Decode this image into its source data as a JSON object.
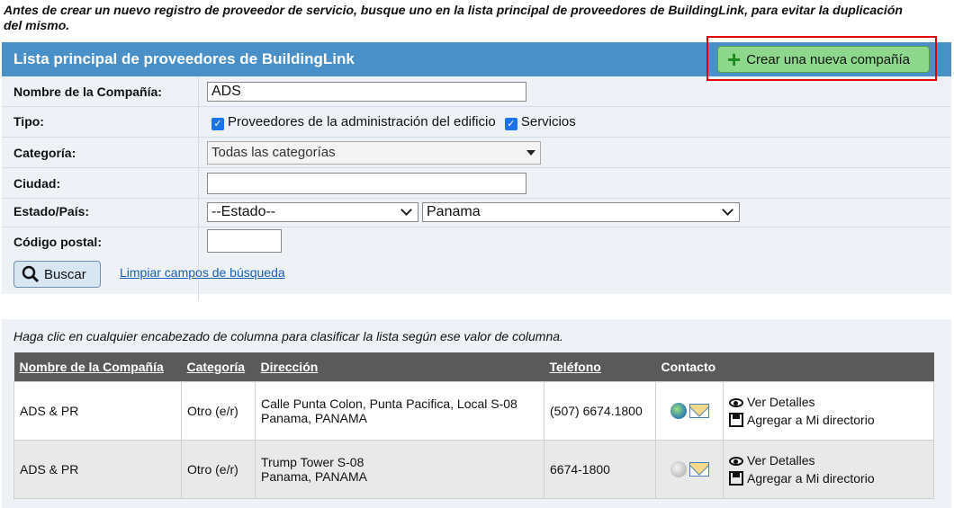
{
  "intro_text": "Antes de crear un nuevo registro de proveedor de servicio, busque uno en la lista principal de proveedores de BuildingLink, para evitar la duplicación del mismo.",
  "panel": {
    "title": "Lista principal de proveedores de BuildingLink",
    "create_button": "Crear una nueva compañía"
  },
  "form": {
    "company_label": "Nombre de la Compañía:",
    "company_value": "ADS",
    "type_label": "Tipo:",
    "type_option1": "Proveedores de la administración del edificio",
    "type_option2": "Servicios",
    "category_label": "Categoría:",
    "category_value": "Todas las categorías",
    "city_label": "Ciudad:",
    "city_value": "",
    "state_label": "Estado/País:",
    "state_value": "--Estado--",
    "country_value": "Panama",
    "zip_label": "Código postal:",
    "zip_value": "",
    "search_button": "Buscar",
    "clear_link": "Limpiar campos de búsqueda"
  },
  "results": {
    "hint": "Haga clic en cualquier encabezado de columna para clasificar la lista según ese valor de columna.",
    "headers": {
      "company": "Nombre de la Compañía",
      "category": "Categoría",
      "address": "Dirección",
      "phone": "Teléfono",
      "contact": "Contacto"
    },
    "rows": [
      {
        "company": "ADS & PR",
        "category": "Otro (e/r)",
        "address1": "Calle Punta Colon, Punta Pacifica, Local S-08",
        "address2": "Panama, PANAMA",
        "phone": "(507) 6674.1800",
        "details": "Ver Detalles",
        "add": "Agregar a Mi directorio"
      },
      {
        "company": "ADS & PR",
        "category": "Otro (e/r)",
        "address1": "Trump Tower S-08",
        "address2": "Panama, PANAMA",
        "phone": "6674-1800",
        "details": "Ver Detalles",
        "add": "Agregar a Mi directorio"
      }
    ]
  }
}
